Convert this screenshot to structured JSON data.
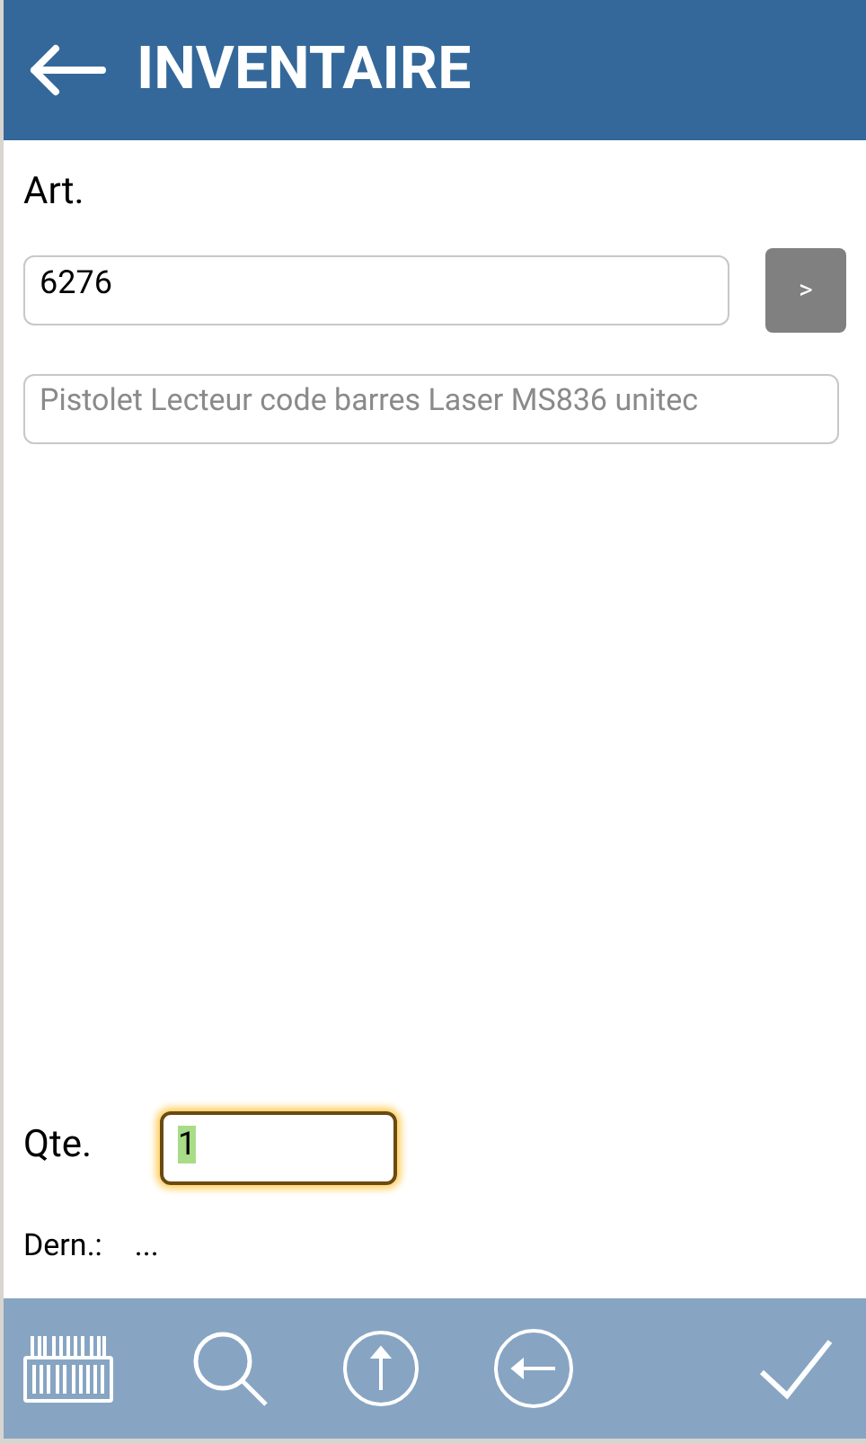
{
  "header": {
    "title": "INVENTAIRE"
  },
  "article": {
    "label": "Art.",
    "value": "6276",
    "button": ">"
  },
  "description": {
    "value": "Pistolet Lecteur code barres Laser MS836 unitec",
    "disabled": true
  },
  "quantity": {
    "label": "Qte.",
    "value": "1",
    "focused": true
  },
  "last": {
    "label": "Dern.:",
    "value": "..."
  },
  "toolbar": [
    {
      "kind": "barcode"
    },
    {
      "kind": "search"
    },
    {
      "kind": "up"
    },
    {
      "kind": "back"
    },
    {
      "kind": "confirm"
    }
  ]
}
